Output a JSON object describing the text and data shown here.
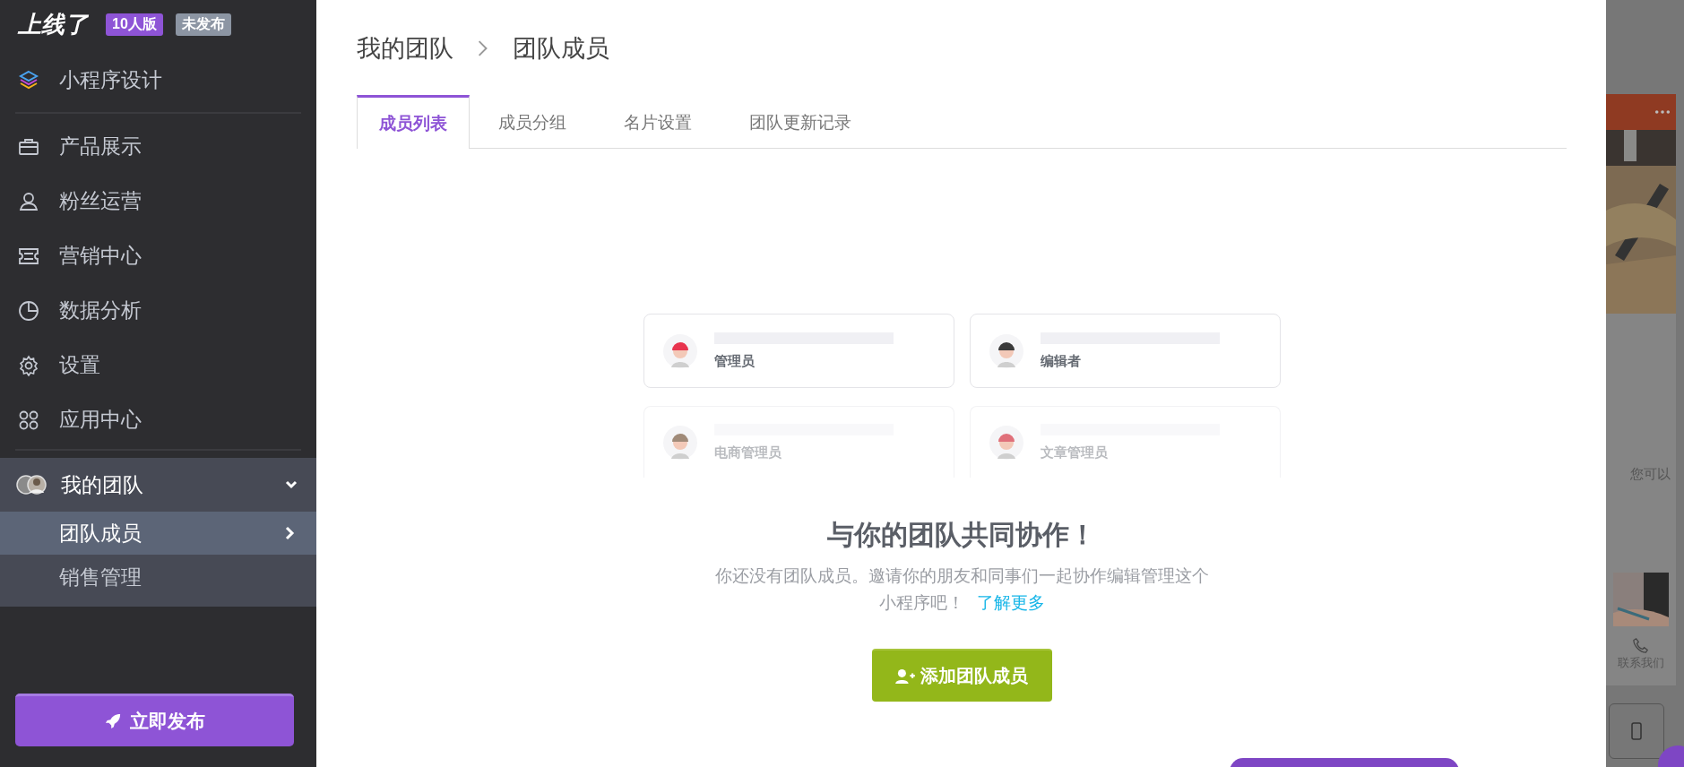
{
  "sidebar": {
    "brand": "上线了",
    "badges": [
      {
        "text": "10人版",
        "color": "#8e54d6"
      },
      {
        "text": "未发布",
        "color": "#8c95a3"
      }
    ],
    "design_item": {
      "label": "小程序设计"
    },
    "items": [
      {
        "label": "产品展示",
        "kind": "briefcase"
      },
      {
        "label": "粉丝运营",
        "kind": "person"
      },
      {
        "label": "营销中心",
        "kind": "ticket"
      },
      {
        "label": "数据分析",
        "kind": "pie"
      },
      {
        "label": "设置",
        "kind": "gear"
      },
      {
        "label": "应用中心",
        "kind": "apps"
      }
    ],
    "team": {
      "label": "我的团队",
      "expanded": true,
      "children": [
        {
          "label": "团队成员",
          "selected": true
        },
        {
          "label": "销售管理",
          "selected": false
        }
      ]
    },
    "publish_button": "立即发布"
  },
  "main": {
    "breadcrumb": [
      "我的团队",
      "团队成员"
    ],
    "tabs": [
      {
        "label": "成员列表",
        "selected": true
      },
      {
        "label": "成员分组",
        "selected": false
      },
      {
        "label": "名片设置",
        "selected": false
      },
      {
        "label": "团队更新记录",
        "selected": false
      }
    ],
    "role_cards": [
      {
        "role": "管理员",
        "color": "#e8344e",
        "faded": false
      },
      {
        "role": "编辑者",
        "color": "#3a3a3a",
        "faded": false
      },
      {
        "role": "电商管理员",
        "color": "#a08a78",
        "faded": true
      },
      {
        "role": "文章管理员",
        "color": "#e0707a",
        "faded": true
      }
    ],
    "heading": "与你的团队共同协作！",
    "description": "你还没有团队成员。邀请你的朋友和同事们一起协作编辑管理这个小程序吧！",
    "link": "了解更多",
    "add_button": "添加团队成员"
  },
  "background_page": {
    "text": "您可以",
    "contact": "联系我们"
  }
}
